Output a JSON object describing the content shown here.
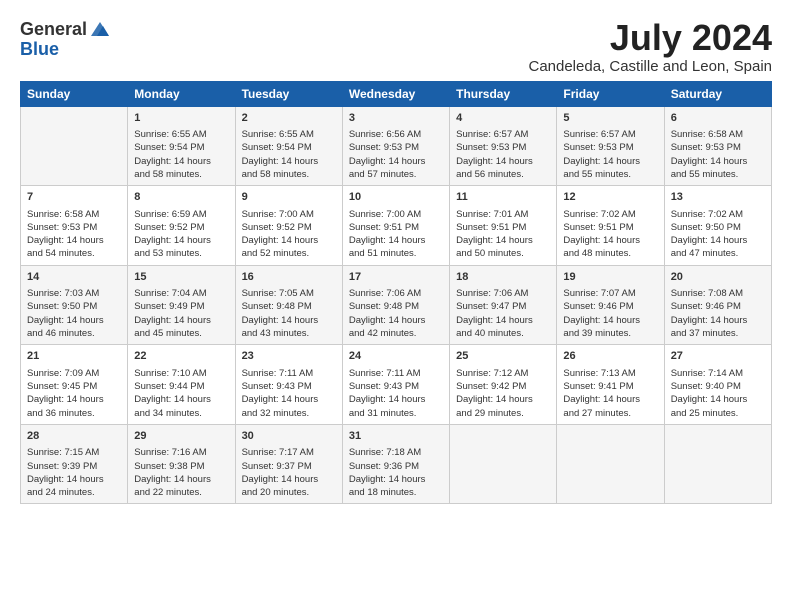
{
  "logo": {
    "general": "General",
    "blue": "Blue"
  },
  "title": "July 2024",
  "location": "Candeleda, Castille and Leon, Spain",
  "header": {
    "days": [
      "Sunday",
      "Monday",
      "Tuesday",
      "Wednesday",
      "Thursday",
      "Friday",
      "Saturday"
    ]
  },
  "weeks": [
    [
      {
        "day": "",
        "content": ""
      },
      {
        "day": "1",
        "content": "Sunrise: 6:55 AM\nSunset: 9:54 PM\nDaylight: 14 hours\nand 58 minutes."
      },
      {
        "day": "2",
        "content": "Sunrise: 6:55 AM\nSunset: 9:54 PM\nDaylight: 14 hours\nand 58 minutes."
      },
      {
        "day": "3",
        "content": "Sunrise: 6:56 AM\nSunset: 9:53 PM\nDaylight: 14 hours\nand 57 minutes."
      },
      {
        "day": "4",
        "content": "Sunrise: 6:57 AM\nSunset: 9:53 PM\nDaylight: 14 hours\nand 56 minutes."
      },
      {
        "day": "5",
        "content": "Sunrise: 6:57 AM\nSunset: 9:53 PM\nDaylight: 14 hours\nand 55 minutes."
      },
      {
        "day": "6",
        "content": "Sunrise: 6:58 AM\nSunset: 9:53 PM\nDaylight: 14 hours\nand 55 minutes."
      }
    ],
    [
      {
        "day": "7",
        "content": "Sunrise: 6:58 AM\nSunset: 9:53 PM\nDaylight: 14 hours\nand 54 minutes."
      },
      {
        "day": "8",
        "content": "Sunrise: 6:59 AM\nSunset: 9:52 PM\nDaylight: 14 hours\nand 53 minutes."
      },
      {
        "day": "9",
        "content": "Sunrise: 7:00 AM\nSunset: 9:52 PM\nDaylight: 14 hours\nand 52 minutes."
      },
      {
        "day": "10",
        "content": "Sunrise: 7:00 AM\nSunset: 9:51 PM\nDaylight: 14 hours\nand 51 minutes."
      },
      {
        "day": "11",
        "content": "Sunrise: 7:01 AM\nSunset: 9:51 PM\nDaylight: 14 hours\nand 50 minutes."
      },
      {
        "day": "12",
        "content": "Sunrise: 7:02 AM\nSunset: 9:51 PM\nDaylight: 14 hours\nand 48 minutes."
      },
      {
        "day": "13",
        "content": "Sunrise: 7:02 AM\nSunset: 9:50 PM\nDaylight: 14 hours\nand 47 minutes."
      }
    ],
    [
      {
        "day": "14",
        "content": "Sunrise: 7:03 AM\nSunset: 9:50 PM\nDaylight: 14 hours\nand 46 minutes."
      },
      {
        "day": "15",
        "content": "Sunrise: 7:04 AM\nSunset: 9:49 PM\nDaylight: 14 hours\nand 45 minutes."
      },
      {
        "day": "16",
        "content": "Sunrise: 7:05 AM\nSunset: 9:48 PM\nDaylight: 14 hours\nand 43 minutes."
      },
      {
        "day": "17",
        "content": "Sunrise: 7:06 AM\nSunset: 9:48 PM\nDaylight: 14 hours\nand 42 minutes."
      },
      {
        "day": "18",
        "content": "Sunrise: 7:06 AM\nSunset: 9:47 PM\nDaylight: 14 hours\nand 40 minutes."
      },
      {
        "day": "19",
        "content": "Sunrise: 7:07 AM\nSunset: 9:46 PM\nDaylight: 14 hours\nand 39 minutes."
      },
      {
        "day": "20",
        "content": "Sunrise: 7:08 AM\nSunset: 9:46 PM\nDaylight: 14 hours\nand 37 minutes."
      }
    ],
    [
      {
        "day": "21",
        "content": "Sunrise: 7:09 AM\nSunset: 9:45 PM\nDaylight: 14 hours\nand 36 minutes."
      },
      {
        "day": "22",
        "content": "Sunrise: 7:10 AM\nSunset: 9:44 PM\nDaylight: 14 hours\nand 34 minutes."
      },
      {
        "day": "23",
        "content": "Sunrise: 7:11 AM\nSunset: 9:43 PM\nDaylight: 14 hours\nand 32 minutes."
      },
      {
        "day": "24",
        "content": "Sunrise: 7:11 AM\nSunset: 9:43 PM\nDaylight: 14 hours\nand 31 minutes."
      },
      {
        "day": "25",
        "content": "Sunrise: 7:12 AM\nSunset: 9:42 PM\nDaylight: 14 hours\nand 29 minutes."
      },
      {
        "day": "26",
        "content": "Sunrise: 7:13 AM\nSunset: 9:41 PM\nDaylight: 14 hours\nand 27 minutes."
      },
      {
        "day": "27",
        "content": "Sunrise: 7:14 AM\nSunset: 9:40 PM\nDaylight: 14 hours\nand 25 minutes."
      }
    ],
    [
      {
        "day": "28",
        "content": "Sunrise: 7:15 AM\nSunset: 9:39 PM\nDaylight: 14 hours\nand 24 minutes."
      },
      {
        "day": "29",
        "content": "Sunrise: 7:16 AM\nSunset: 9:38 PM\nDaylight: 14 hours\nand 22 minutes."
      },
      {
        "day": "30",
        "content": "Sunrise: 7:17 AM\nSunset: 9:37 PM\nDaylight: 14 hours\nand 20 minutes."
      },
      {
        "day": "31",
        "content": "Sunrise: 7:18 AM\nSunset: 9:36 PM\nDaylight: 14 hours\nand 18 minutes."
      },
      {
        "day": "",
        "content": ""
      },
      {
        "day": "",
        "content": ""
      },
      {
        "day": "",
        "content": ""
      }
    ]
  ]
}
